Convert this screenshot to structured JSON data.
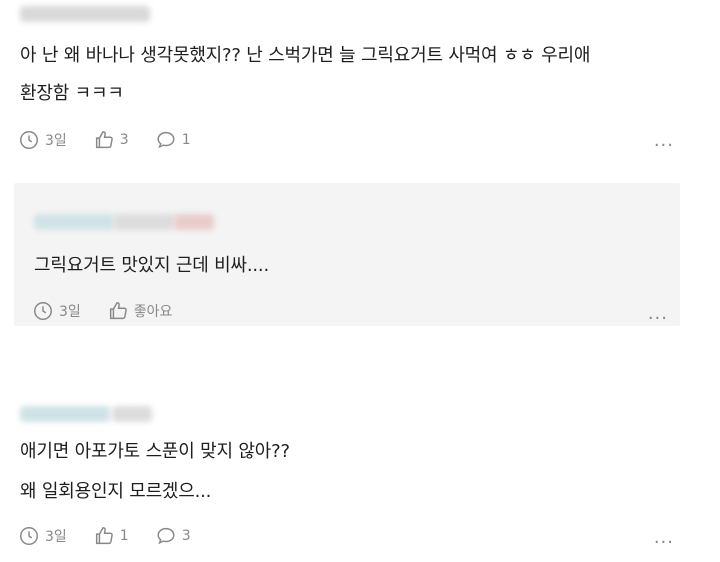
{
  "comments": [
    {
      "text_line1": "아 난 왜 바나나 생각못했지?? 난 스벅가면 늘 그릭요거트 사먹여 ㅎㅎ 우리애",
      "text_line2": "환장함 ㅋㅋㅋ",
      "time": "3일",
      "likes": "3",
      "replies": "1",
      "more": "..."
    },
    {
      "text_line1": "그릭요거트 맛있지 근데 비싸....",
      "time": "3일",
      "likes": "좋아요",
      "more": "..."
    },
    {
      "text_line1": "애기면 아포가토 스푼이 맞지 않아??",
      "text_line2": "왜 일회용인지 모르겠으...",
      "time": "3일",
      "likes": "1",
      "replies": "3",
      "more": "..."
    }
  ]
}
